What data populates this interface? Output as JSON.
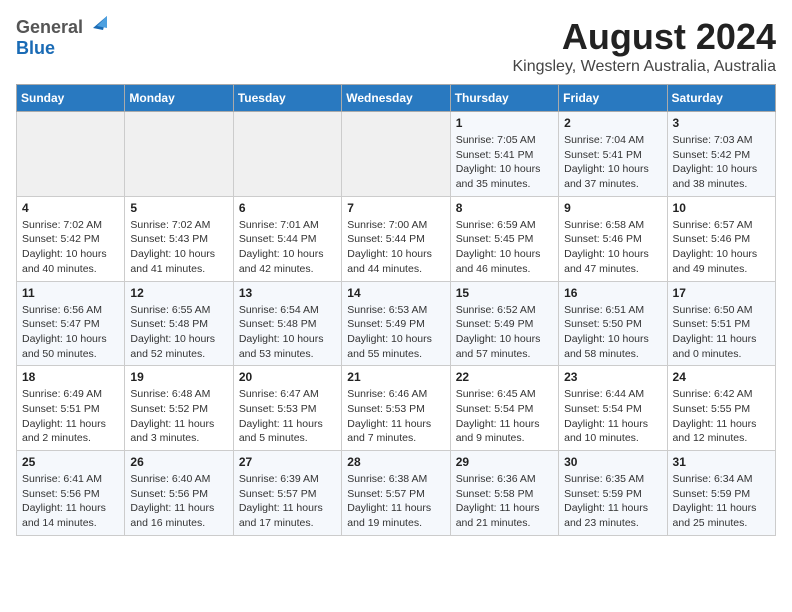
{
  "header": {
    "logo_general": "General",
    "logo_blue": "Blue",
    "month_year": "August 2024",
    "location": "Kingsley, Western Australia, Australia"
  },
  "days_of_week": [
    "Sunday",
    "Monday",
    "Tuesday",
    "Wednesday",
    "Thursday",
    "Friday",
    "Saturday"
  ],
  "weeks": [
    [
      {
        "day": "",
        "info": ""
      },
      {
        "day": "",
        "info": ""
      },
      {
        "day": "",
        "info": ""
      },
      {
        "day": "",
        "info": ""
      },
      {
        "day": "1",
        "info": "Sunrise: 7:05 AM\nSunset: 5:41 PM\nDaylight: 10 hours\nand 35 minutes."
      },
      {
        "day": "2",
        "info": "Sunrise: 7:04 AM\nSunset: 5:41 PM\nDaylight: 10 hours\nand 37 minutes."
      },
      {
        "day": "3",
        "info": "Sunrise: 7:03 AM\nSunset: 5:42 PM\nDaylight: 10 hours\nand 38 minutes."
      }
    ],
    [
      {
        "day": "4",
        "info": "Sunrise: 7:02 AM\nSunset: 5:42 PM\nDaylight: 10 hours\nand 40 minutes."
      },
      {
        "day": "5",
        "info": "Sunrise: 7:02 AM\nSunset: 5:43 PM\nDaylight: 10 hours\nand 41 minutes."
      },
      {
        "day": "6",
        "info": "Sunrise: 7:01 AM\nSunset: 5:44 PM\nDaylight: 10 hours\nand 42 minutes."
      },
      {
        "day": "7",
        "info": "Sunrise: 7:00 AM\nSunset: 5:44 PM\nDaylight: 10 hours\nand 44 minutes."
      },
      {
        "day": "8",
        "info": "Sunrise: 6:59 AM\nSunset: 5:45 PM\nDaylight: 10 hours\nand 46 minutes."
      },
      {
        "day": "9",
        "info": "Sunrise: 6:58 AM\nSunset: 5:46 PM\nDaylight: 10 hours\nand 47 minutes."
      },
      {
        "day": "10",
        "info": "Sunrise: 6:57 AM\nSunset: 5:46 PM\nDaylight: 10 hours\nand 49 minutes."
      }
    ],
    [
      {
        "day": "11",
        "info": "Sunrise: 6:56 AM\nSunset: 5:47 PM\nDaylight: 10 hours\nand 50 minutes."
      },
      {
        "day": "12",
        "info": "Sunrise: 6:55 AM\nSunset: 5:48 PM\nDaylight: 10 hours\nand 52 minutes."
      },
      {
        "day": "13",
        "info": "Sunrise: 6:54 AM\nSunset: 5:48 PM\nDaylight: 10 hours\nand 53 minutes."
      },
      {
        "day": "14",
        "info": "Sunrise: 6:53 AM\nSunset: 5:49 PM\nDaylight: 10 hours\nand 55 minutes."
      },
      {
        "day": "15",
        "info": "Sunrise: 6:52 AM\nSunset: 5:49 PM\nDaylight: 10 hours\nand 57 minutes."
      },
      {
        "day": "16",
        "info": "Sunrise: 6:51 AM\nSunset: 5:50 PM\nDaylight: 10 hours\nand 58 minutes."
      },
      {
        "day": "17",
        "info": "Sunrise: 6:50 AM\nSunset: 5:51 PM\nDaylight: 11 hours\nand 0 minutes."
      }
    ],
    [
      {
        "day": "18",
        "info": "Sunrise: 6:49 AM\nSunset: 5:51 PM\nDaylight: 11 hours\nand 2 minutes."
      },
      {
        "day": "19",
        "info": "Sunrise: 6:48 AM\nSunset: 5:52 PM\nDaylight: 11 hours\nand 3 minutes."
      },
      {
        "day": "20",
        "info": "Sunrise: 6:47 AM\nSunset: 5:53 PM\nDaylight: 11 hours\nand 5 minutes."
      },
      {
        "day": "21",
        "info": "Sunrise: 6:46 AM\nSunset: 5:53 PM\nDaylight: 11 hours\nand 7 minutes."
      },
      {
        "day": "22",
        "info": "Sunrise: 6:45 AM\nSunset: 5:54 PM\nDaylight: 11 hours\nand 9 minutes."
      },
      {
        "day": "23",
        "info": "Sunrise: 6:44 AM\nSunset: 5:54 PM\nDaylight: 11 hours\nand 10 minutes."
      },
      {
        "day": "24",
        "info": "Sunrise: 6:42 AM\nSunset: 5:55 PM\nDaylight: 11 hours\nand 12 minutes."
      }
    ],
    [
      {
        "day": "25",
        "info": "Sunrise: 6:41 AM\nSunset: 5:56 PM\nDaylight: 11 hours\nand 14 minutes."
      },
      {
        "day": "26",
        "info": "Sunrise: 6:40 AM\nSunset: 5:56 PM\nDaylight: 11 hours\nand 16 minutes."
      },
      {
        "day": "27",
        "info": "Sunrise: 6:39 AM\nSunset: 5:57 PM\nDaylight: 11 hours\nand 17 minutes."
      },
      {
        "day": "28",
        "info": "Sunrise: 6:38 AM\nSunset: 5:57 PM\nDaylight: 11 hours\nand 19 minutes."
      },
      {
        "day": "29",
        "info": "Sunrise: 6:36 AM\nSunset: 5:58 PM\nDaylight: 11 hours\nand 21 minutes."
      },
      {
        "day": "30",
        "info": "Sunrise: 6:35 AM\nSunset: 5:59 PM\nDaylight: 11 hours\nand 23 minutes."
      },
      {
        "day": "31",
        "info": "Sunrise: 6:34 AM\nSunset: 5:59 PM\nDaylight: 11 hours\nand 25 minutes."
      }
    ]
  ]
}
